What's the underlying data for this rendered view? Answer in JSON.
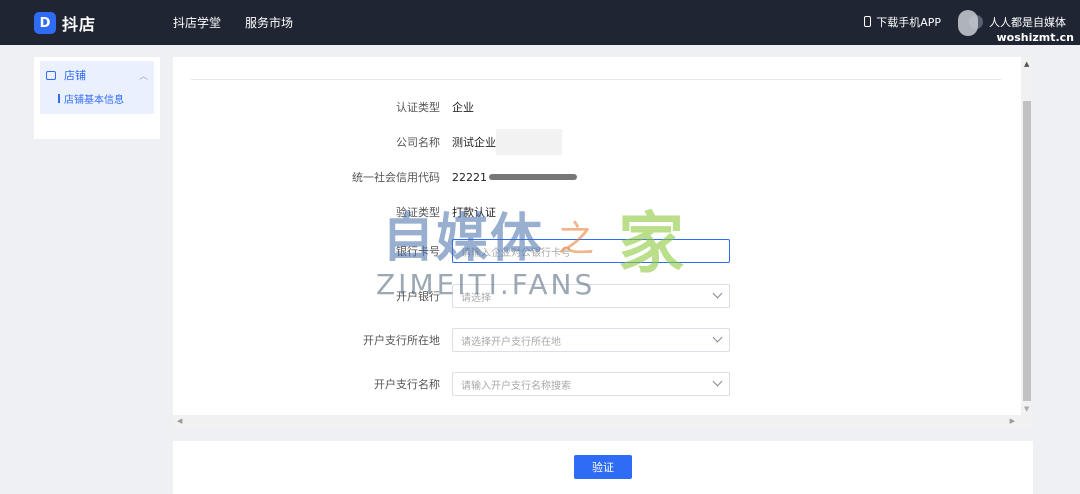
{
  "topbar": {
    "logo_mark": "D",
    "logo_text": "抖店",
    "nav": [
      "抖店学堂",
      "服务市场"
    ],
    "download_app": "下载手机APP",
    "user_name": "人人都是自媒体",
    "watermark_url": "woshizmt.cn"
  },
  "sidebar": {
    "group_label": "店铺",
    "items": [
      "店铺基本信息"
    ]
  },
  "form": {
    "rows": [
      {
        "label": "认证类型",
        "value": "企业"
      },
      {
        "label": "公司名称",
        "value": "测试企业"
      },
      {
        "label": "统一社会信用代码",
        "value": "22221"
      },
      {
        "label": "验证类型",
        "value": "打款认证"
      }
    ],
    "bank_card": {
      "label": "银行卡号",
      "placeholder": "请输入企业对公银行卡号"
    },
    "bank": {
      "label": "开户银行",
      "placeholder": "请选择"
    },
    "branch_location": {
      "label": "开户支行所在地",
      "placeholder": "请选择开户支行所在地"
    },
    "branch_name": {
      "label": "开户支行名称",
      "placeholder": "请输入开户支行名称搜索"
    }
  },
  "footer": {
    "verify_label": "验证"
  },
  "watermark": {
    "cn_main": "自媒体",
    "cn_zhi": "之",
    "cn_jia": "家",
    "en": "ZIMEITI.FANS"
  },
  "colors": {
    "primary": "#2f6cf6",
    "topbar_bg": "#1f2533"
  }
}
